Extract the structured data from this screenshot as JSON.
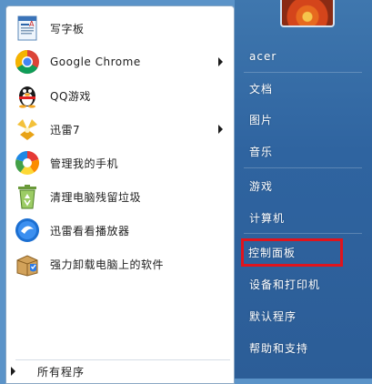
{
  "programs": [
    {
      "label": "写字板",
      "icon": "wordpad-icon",
      "has_submenu": false
    },
    {
      "label": "Google Chrome",
      "icon": "chrome-icon",
      "has_submenu": true
    },
    {
      "label": "QQ游戏",
      "icon": "qq-penguin-icon",
      "has_submenu": false
    },
    {
      "label": "迅雷7",
      "icon": "thunder-bird-icon",
      "has_submenu": true
    },
    {
      "label": "管理我的手机",
      "icon": "phone-manager-icon",
      "has_submenu": false
    },
    {
      "label": "清理电脑残留垃圾",
      "icon": "recycle-icon",
      "has_submenu": false
    },
    {
      "label": "迅雷看看播放器",
      "icon": "media-player-icon",
      "has_submenu": false
    },
    {
      "label": "强力卸载电脑上的软件",
      "icon": "uninstall-box-icon",
      "has_submenu": false
    }
  ],
  "all_programs": {
    "label": "所有程序"
  },
  "places": [
    {
      "label": "acer"
    },
    {
      "label": "文档"
    },
    {
      "label": "图片"
    },
    {
      "label": "音乐"
    },
    {
      "label": "游戏"
    },
    {
      "label": "计算机"
    },
    {
      "label": "控制面板",
      "highlighted": true
    },
    {
      "label": "设备和打印机"
    },
    {
      "label": "默认程序"
    },
    {
      "label": "帮助和支持"
    }
  ],
  "colors": {
    "right_pane": "#2f64a0",
    "highlight_border": "#e0141c"
  }
}
